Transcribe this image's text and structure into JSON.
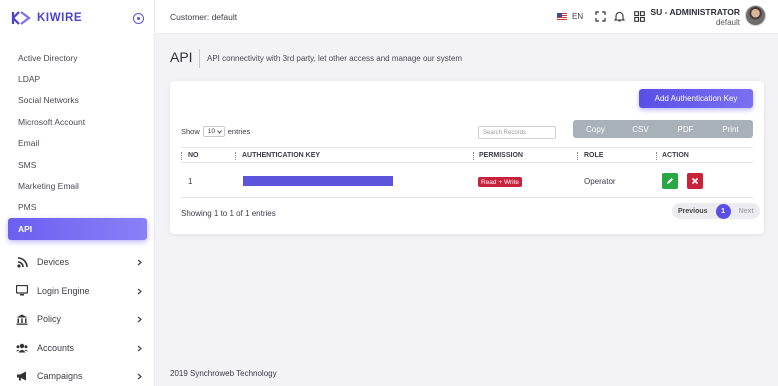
{
  "brand": {
    "name": "KIWIRE"
  },
  "sidebar": {
    "sub_items": [
      {
        "label": "Active Directory"
      },
      {
        "label": "LDAP"
      },
      {
        "label": "Social Networks"
      },
      {
        "label": "Microsoft Account"
      },
      {
        "label": "Email"
      },
      {
        "label": "SMS"
      },
      {
        "label": "Marketing Email"
      },
      {
        "label": "PMS"
      },
      {
        "label": "API",
        "active": true
      }
    ],
    "main_items": [
      {
        "label": "Devices",
        "icon": "rss-icon"
      },
      {
        "label": "Login Engine",
        "icon": "monitor-icon"
      },
      {
        "label": "Policy",
        "icon": "bank-icon"
      },
      {
        "label": "Accounts",
        "icon": "users-icon"
      },
      {
        "label": "Campaigns",
        "icon": "megaphone-icon"
      }
    ]
  },
  "topbar": {
    "customer": "Customer: default",
    "language": "EN",
    "user_name": "SU - ADMINISTRATOR",
    "user_role": "default"
  },
  "page": {
    "title": "API",
    "description": "API connectivity with 3rd party, let other access and manage our system"
  },
  "card": {
    "add_button": "Add Authentication Key",
    "show_label": "Show",
    "show_value": "10",
    "entries_label": "entries",
    "search_placeholder": "Search Records",
    "export_buttons": [
      "Copy",
      "CSV",
      "PDF",
      "Print"
    ],
    "columns": [
      "NO",
      "AUTHENTICATION KEY",
      "PERMISSION",
      "ROLE",
      "ACTION"
    ],
    "rows": [
      {
        "no": "1",
        "key_masked": true,
        "permission": "Read + Write",
        "role": "Operator"
      }
    ],
    "showing": "Showing 1 to 1 of 1 entries",
    "pager": {
      "previous": "Previous",
      "current": "1",
      "next": "Next"
    }
  },
  "footer": {
    "text": "2019 Synchroweb Technology"
  },
  "colors": {
    "accent": "#5a4fe6",
    "danger": "#c8233a",
    "success": "#27a845",
    "export": "#a8b0b8"
  }
}
